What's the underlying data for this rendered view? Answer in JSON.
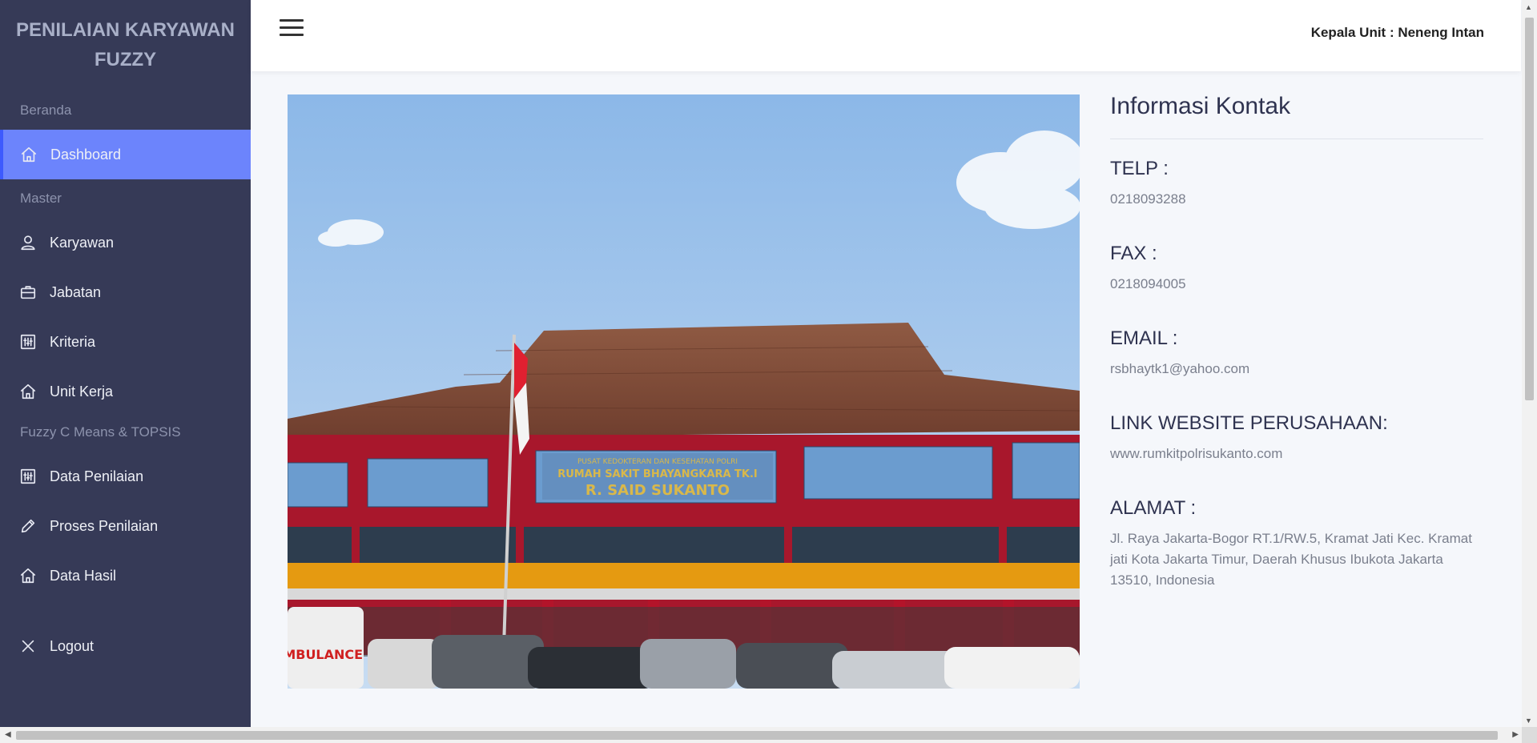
{
  "brand": {
    "title": "PENILAIAN KARYAWAN FUZZY"
  },
  "sidebar": {
    "sections": [
      {
        "title": "Beranda",
        "items": [
          {
            "label": "Dashboard",
            "icon": "home-icon",
            "active": true
          }
        ]
      },
      {
        "title": "Master",
        "items": [
          {
            "label": "Karyawan",
            "icon": "user-icon"
          },
          {
            "label": "Jabatan",
            "icon": "briefcase-icon"
          },
          {
            "label": "Kriteria",
            "icon": "sliders-icon"
          },
          {
            "label": "Unit Kerja",
            "icon": "home-icon"
          }
        ]
      },
      {
        "title": "Fuzzy C Means & TOPSIS",
        "items": [
          {
            "label": "Data Penilaian",
            "icon": "sliders-icon"
          },
          {
            "label": "Proses Penilaian",
            "icon": "pencil-icon"
          },
          {
            "label": "Data Hasil",
            "icon": "home-icon"
          }
        ]
      }
    ],
    "logout_label": "Logout"
  },
  "header": {
    "user_label": "Kepala Unit : Neneng Intan"
  },
  "photo": {
    "description_text": "",
    "sign_lines": [
      "PUSAT KEDOKTERAN DAN KESEHATAN POLRI",
      "RUMAH SAKIT BHAYANGKARA TK.I",
      "R. SAID SUKANTO"
    ],
    "ambulance_text": "AMBULANCE"
  },
  "contact": {
    "heading": "Informasi Kontak",
    "telp_label": "TELP :",
    "telp_value": "0218093288",
    "fax_label": "FAX :",
    "fax_value": "0218094005",
    "email_label": "EMAIL :",
    "email_value": "rsbhaytk1@yahoo.com",
    "website_label": "LINK WEBSITE PERUSAHAAN:",
    "website_value": "www.rumkitpolrisukanto.com",
    "address_label": "ALAMAT :",
    "address_value": "Jl. Raya Jakarta-Bogor RT.1/RW.5, Kramat Jati Kec. Kramat jati Kota Jakarta Timur, Daerah Khusus Ibukota Jakarta 13510, Indonesia"
  },
  "colors": {
    "sidebar_bg": "#363a57",
    "active_bg": "#6c84fc",
    "accent": "#3d5afe"
  }
}
